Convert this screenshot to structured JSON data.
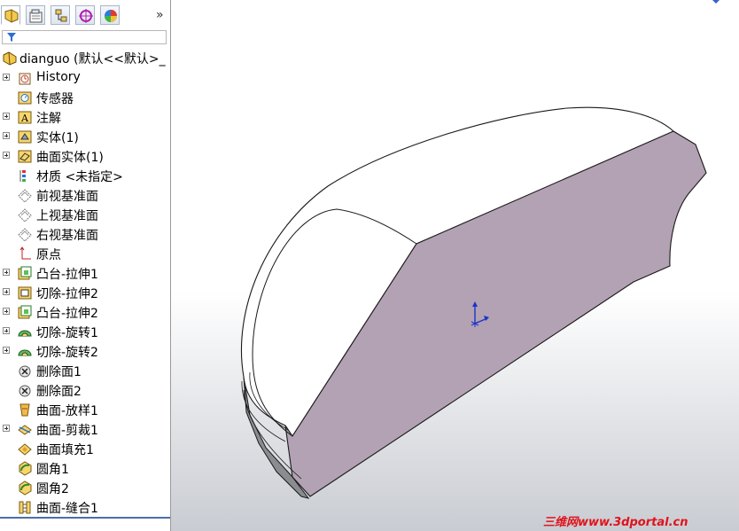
{
  "feature_manager": {
    "tabs": [
      {
        "name": "feature-tree-tab",
        "icon": "feature-tree-icon"
      },
      {
        "name": "property-manager-tab",
        "icon": "property-manager-icon"
      },
      {
        "name": "configuration-manager-tab",
        "icon": "configuration-manager-icon"
      },
      {
        "name": "dimxpert-tab",
        "icon": "dimxpert-icon"
      },
      {
        "name": "display-manager-tab",
        "icon": "display-manager-icon"
      }
    ],
    "more_symbol": "»",
    "filter_icon": "filter-icon",
    "root_label": "dianguo (默认<<默认>_",
    "items": [
      {
        "label": "History",
        "icon": "history-icon",
        "expandable": true
      },
      {
        "label": "传感器",
        "icon": "sensor-icon",
        "expandable": false
      },
      {
        "label": "注解",
        "icon": "annotation-icon",
        "expandable": true
      },
      {
        "label": "实体(1)",
        "icon": "solid-bodies-icon",
        "expandable": true
      },
      {
        "label": "曲面实体(1)",
        "icon": "surface-bodies-icon",
        "expandable": true
      },
      {
        "label": "材质 <未指定>",
        "icon": "material-icon",
        "expandable": false
      },
      {
        "label": "前视基准面",
        "icon": "plane-icon",
        "expandable": false
      },
      {
        "label": "上视基准面",
        "icon": "plane-icon",
        "expandable": false
      },
      {
        "label": "右视基准面",
        "icon": "plane-icon",
        "expandable": false
      },
      {
        "label": "原点",
        "icon": "origin-icon",
        "expandable": false
      },
      {
        "label": "凸台-拉伸1",
        "icon": "boss-extrude-icon",
        "expandable": true
      },
      {
        "label": "切除-拉伸2",
        "icon": "cut-extrude-icon",
        "expandable": true
      },
      {
        "label": "凸台-拉伸2",
        "icon": "boss-extrude-icon",
        "expandable": true
      },
      {
        "label": "切除-旋转1",
        "icon": "cut-revolve-icon",
        "expandable": true
      },
      {
        "label": "切除-旋转2",
        "icon": "cut-revolve-icon",
        "expandable": true
      },
      {
        "label": "删除面1",
        "icon": "delete-face-icon",
        "expandable": false
      },
      {
        "label": "删除面2",
        "icon": "delete-face-icon",
        "expandable": false
      },
      {
        "label": "曲面-放样1",
        "icon": "surface-loft-icon",
        "expandable": false
      },
      {
        "label": "曲面-剪裁1",
        "icon": "surface-trim-icon",
        "expandable": true
      },
      {
        "label": "曲面填充1",
        "icon": "surface-fill-icon",
        "expandable": false
      },
      {
        "label": "圆角1",
        "icon": "fillet-icon",
        "expandable": false
      },
      {
        "label": "圆角2",
        "icon": "fillet-icon",
        "expandable": false
      },
      {
        "label": "曲面-缝合1",
        "icon": "surface-knit-icon",
        "expandable": false
      }
    ]
  },
  "watermark": "三维网www.3dportal.cn",
  "colors": {
    "cut_face": "#b3a1b4",
    "model_outline": "#1a1a1a",
    "viewport_gradient_top": "#ffffff",
    "viewport_gradient_bottom": "#c9ccd2",
    "triad": "#1a33c8"
  }
}
